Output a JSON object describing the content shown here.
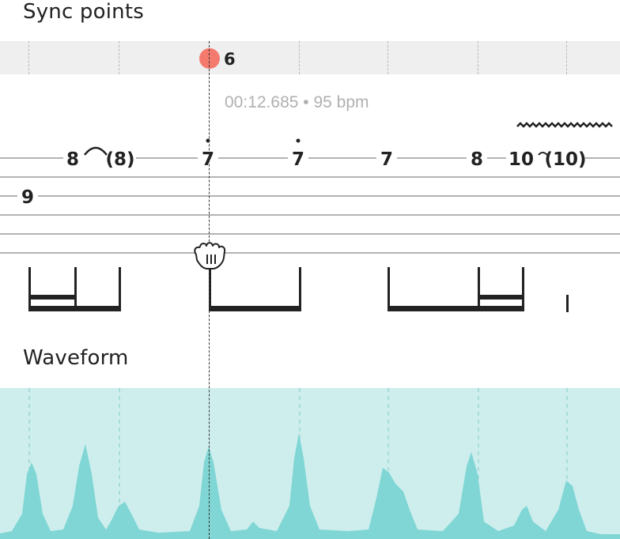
{
  "sync_section": {
    "title": "Sync points",
    "marker_label": "6",
    "time_readout": "00:12.685 • 95 bpm"
  },
  "tab": {
    "notes": [
      {
        "text": "8"
      },
      {
        "text": "(8)"
      },
      {
        "text": "7"
      },
      {
        "text": "7"
      },
      {
        "text": "7"
      },
      {
        "text": "8"
      },
      {
        "text": "10"
      },
      {
        "text": "(10)"
      },
      {
        "text": "9"
      }
    ]
  },
  "waveform_section": {
    "title": "Waveform"
  },
  "colors": {
    "sync_marker": "#f47a6e",
    "waveform_fill": "#7fd6d4",
    "waveform_background": "#cdeeed"
  },
  "icons": {
    "grab_cursor": "hand-grab-icon"
  }
}
